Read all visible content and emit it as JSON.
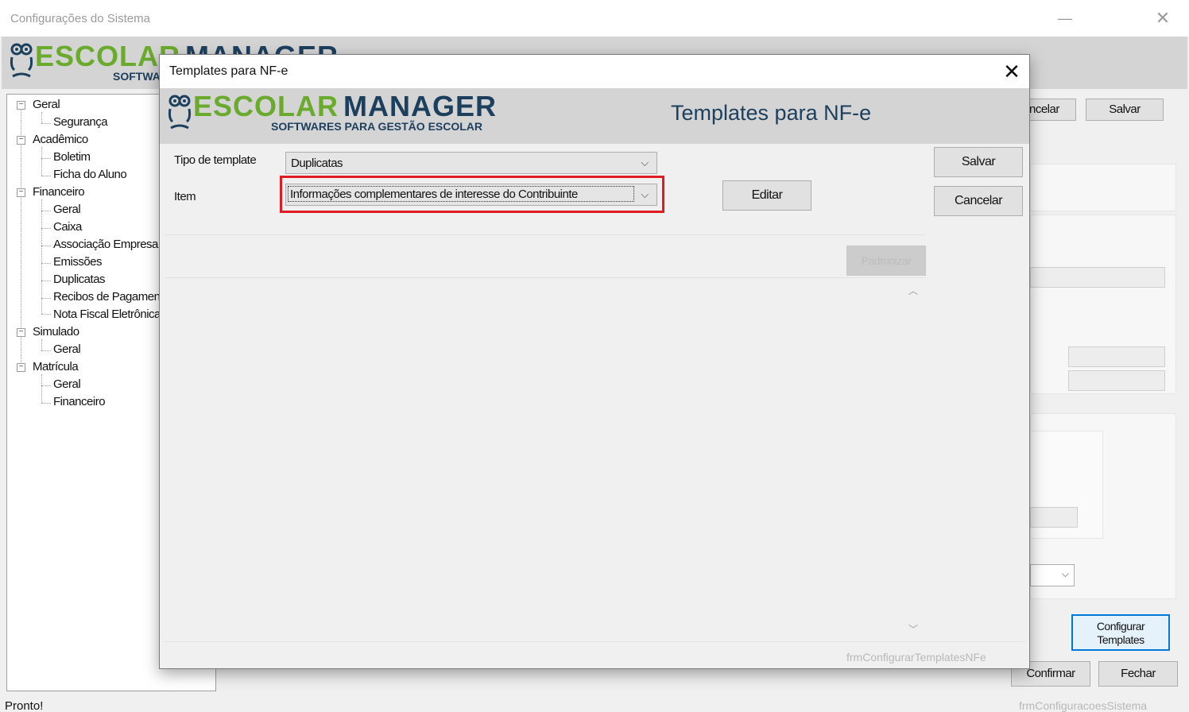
{
  "background_window": {
    "title": "Configurações do Sistema",
    "minimize_glyph": "—",
    "close_glyph": "✕",
    "logo": {
      "word1": "ESCOLAR",
      "word2": "MANAGER",
      "subtitle": "SOFTWARES PARA GESTÃO ESCOLAR"
    },
    "tree": [
      {
        "label": "Geral",
        "level": 0,
        "expander": "−"
      },
      {
        "label": "Segurança",
        "level": 1
      },
      {
        "label": "Acadêmico",
        "level": 0,
        "expander": "−"
      },
      {
        "label": "Boletim",
        "level": 1
      },
      {
        "label": "Ficha do Aluno",
        "level": 1
      },
      {
        "label": "Financeiro",
        "level": 0,
        "expander": "−"
      },
      {
        "label": "Geral",
        "level": 1
      },
      {
        "label": "Caixa",
        "level": 1
      },
      {
        "label": "Associação Empresa",
        "level": 1
      },
      {
        "label": "Emissões",
        "level": 1
      },
      {
        "label": "Duplicatas",
        "level": 1
      },
      {
        "label": "Recibos de Pagamento",
        "level": 1
      },
      {
        "label": "Nota Fiscal Eletrônica",
        "level": 1
      },
      {
        "label": "Simulado",
        "level": 0,
        "expander": "−"
      },
      {
        "label": "Geral",
        "level": 1
      },
      {
        "label": "Matrícula",
        "level": 0,
        "expander": "−"
      },
      {
        "label": "Geral",
        "level": 1
      },
      {
        "label": "Financeiro",
        "level": 1
      }
    ],
    "buttons": {
      "cancel_partial": "ncelar",
      "save": "Salvar",
      "configure_templates": "Configurar Templates",
      "confirm": "Confirmar",
      "close": "Fechar"
    },
    "status": "Pronto!",
    "form_name": "frmConfiguracoesSistema"
  },
  "dialog": {
    "title": "Templates para NF-e",
    "close_glyph": "✕",
    "logo": {
      "word1": "ESCOLAR",
      "word2": "MANAGER",
      "subtitle": "SOFTWARES PARA GESTÃO ESCOLAR"
    },
    "heading": "Templates para NF-e",
    "fields": {
      "template_type": {
        "label": "Tipo de template",
        "value": "Duplicatas"
      },
      "item": {
        "label": "Item",
        "value": "Informações complementares de interesse do Contribuinte"
      }
    },
    "buttons": {
      "save": "Salvar",
      "cancel": "Cancelar",
      "edit": "Editar",
      "defaults": "Padronizar"
    },
    "form_name": "frmConfigurarTemplatesNFe"
  },
  "colors": {
    "logo_green": "#6aab2d",
    "logo_navy": "#1d3f5e",
    "highlight_red": "#e01b22",
    "accent_blue": "#0078d7"
  }
}
